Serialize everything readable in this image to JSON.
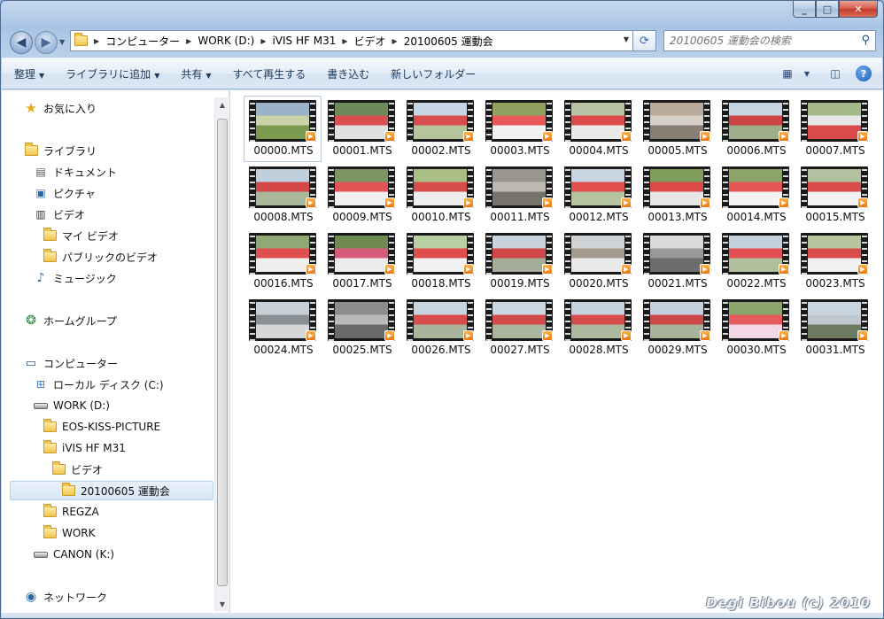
{
  "address": {
    "crumbs": [
      "コンピューター",
      "WORK (D:)",
      "iVIS HF M31",
      "ビデオ",
      "20100605 運動会"
    ],
    "search_placeholder": "20100605 運動会の検索"
  },
  "toolbar": {
    "organize": "整理",
    "add_library": "ライブラリに追加",
    "share": "共有",
    "play_all": "すべて再生する",
    "burn": "書き込む",
    "new_folder": "新しいフォルダー"
  },
  "nav": {
    "favorites": "お気に入り",
    "libraries": "ライブラリ",
    "documents": "ドキュメント",
    "pictures": "ピクチャ",
    "videos": "ビデオ",
    "my_videos": "マイ ビデオ",
    "public_videos": "パブリックのビデオ",
    "music": "ミュージック",
    "homegroup": "ホームグループ",
    "computer": "コンピューター",
    "local_disk": "ローカル ディスク (C:)",
    "work_drive": "WORK (D:)",
    "eos": "EOS-KISS-PICTURE",
    "ivis": "iVIS HF M31",
    "video_folder": "ビデオ",
    "event_folder": "20100605 運動会",
    "regza": "REGZA",
    "work_folder": "WORK",
    "canon": "CANON (K:)",
    "network": "ネットワーク"
  },
  "files": [
    "00000.MTS",
    "00001.MTS",
    "00002.MTS",
    "00003.MTS",
    "00004.MTS",
    "00005.MTS",
    "00006.MTS",
    "00007.MTS",
    "00008.MTS",
    "00009.MTS",
    "00010.MTS",
    "00011.MTS",
    "00012.MTS",
    "00013.MTS",
    "00014.MTS",
    "00015.MTS",
    "00016.MTS",
    "00017.MTS",
    "00018.MTS",
    "00019.MTS",
    "00020.MTS",
    "00021.MTS",
    "00022.MTS",
    "00023.MTS",
    "00024.MTS",
    "00025.MTS",
    "00026.MTS",
    "00027.MTS",
    "00028.MTS",
    "00029.MTS",
    "00030.MTS",
    "00031.MTS"
  ],
  "watermark": "Degi Bibou (c) 2010"
}
